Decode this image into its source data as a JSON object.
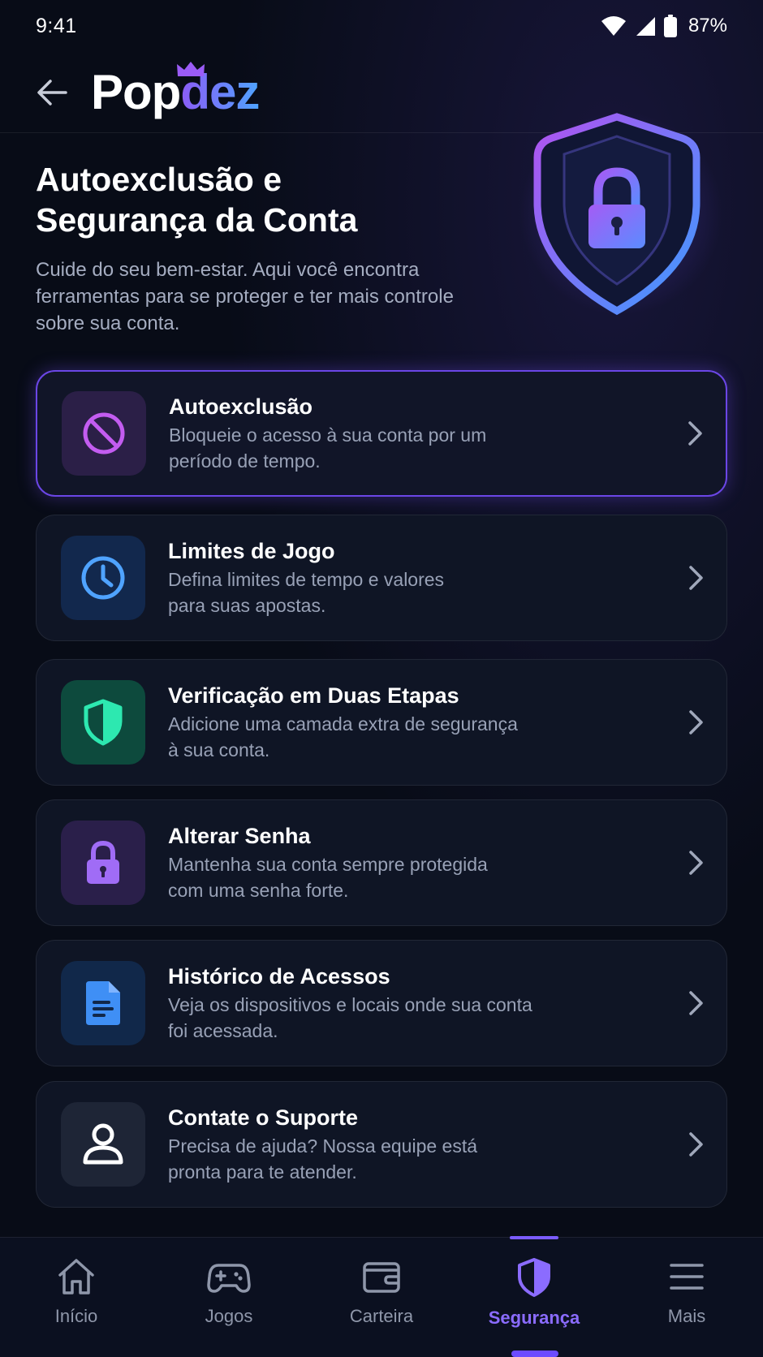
{
  "status_bar": {
    "time": "9:41",
    "battery": "87%"
  },
  "header": {
    "logo_prefix": "Pop",
    "logo_suffix": "dez"
  },
  "hero": {
    "title": "Autoexclusão e\nSegurança da Conta",
    "subtitle": "Cuide do seu bem-estar. Aqui você encontra\nferramentas para se proteger e ter mais controle\nsobre sua conta."
  },
  "items": [
    {
      "title": "Autoexclusão",
      "description": "Bloqueie o acesso à sua conta por um\nperíodo de tempo.",
      "icon": "block-icon",
      "color": "#c35cf0"
    },
    {
      "title": "Limites de Jogo",
      "description": "Defina limites de tempo e valores\npara suas apostas.",
      "icon": "clock-icon",
      "color": "#4fa3ff"
    },
    {
      "title": "Verificação em Duas Etapas",
      "description": "Adicione uma camada extra de segurança\nà sua conta.",
      "icon": "shield-icon",
      "color": "#2de8b0"
    },
    {
      "title": "Alterar Senha",
      "description": "Mantenha sua conta sempre protegida\ncom uma senha forte.",
      "icon": "lock-icon",
      "color": "#a06cf6"
    },
    {
      "title": "Histórico de Acessos",
      "description": "Veja os dispositivos e locais onde sua conta\nfoi acessada.",
      "icon": "document-icon",
      "color": "#3f8ff5"
    },
    {
      "title": "Contate o Suporte",
      "description": "Precisa de ajuda? Nossa equipe está\npronta para te atender.",
      "icon": "user-icon",
      "color": "#ffffff"
    }
  ],
  "bottom_nav": [
    {
      "label": "Início",
      "icon": "home-icon"
    },
    {
      "label": "Jogos",
      "icon": "gamepad-icon"
    },
    {
      "label": "Carteira",
      "icon": "wallet-icon"
    },
    {
      "label": "Segurança",
      "icon": "shield-icon",
      "active": true
    },
    {
      "label": "Mais",
      "icon": "menu-icon"
    }
  ],
  "colors": {
    "background": "#080c17",
    "card": "#0f1525",
    "accent": "#7b5cff",
    "text_secondary": "#98a1b6"
  }
}
